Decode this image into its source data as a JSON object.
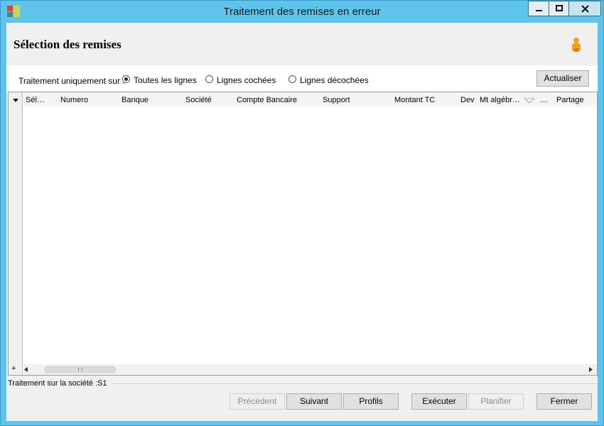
{
  "window": {
    "title": "Traitement des remises en erreur"
  },
  "page": {
    "title": "Sélection des remises"
  },
  "filter": {
    "label": "Traitement uniquement sur :",
    "options": [
      {
        "label": "Toutes les lignes",
        "selected": true
      },
      {
        "label": "Lignes cochées",
        "selected": false
      },
      {
        "label": "Lignes décochées",
        "selected": false
      }
    ],
    "refresh_label": "Actualiser"
  },
  "grid": {
    "columns": [
      "Sél…",
      "Numero",
      "Banque",
      "Société",
      "Compte Bancaire",
      "Support",
      "Montant TC",
      "Dev",
      "Mt algébr…",
      "…",
      "Partage"
    ]
  },
  "status": {
    "text": "Traitement sur la société :S1"
  },
  "actions": {
    "previous": "Précédent",
    "next": "Suivant",
    "profiles": "Profils",
    "execute": "Exécuter",
    "schedule": "Planifier",
    "close": "Fermer"
  }
}
